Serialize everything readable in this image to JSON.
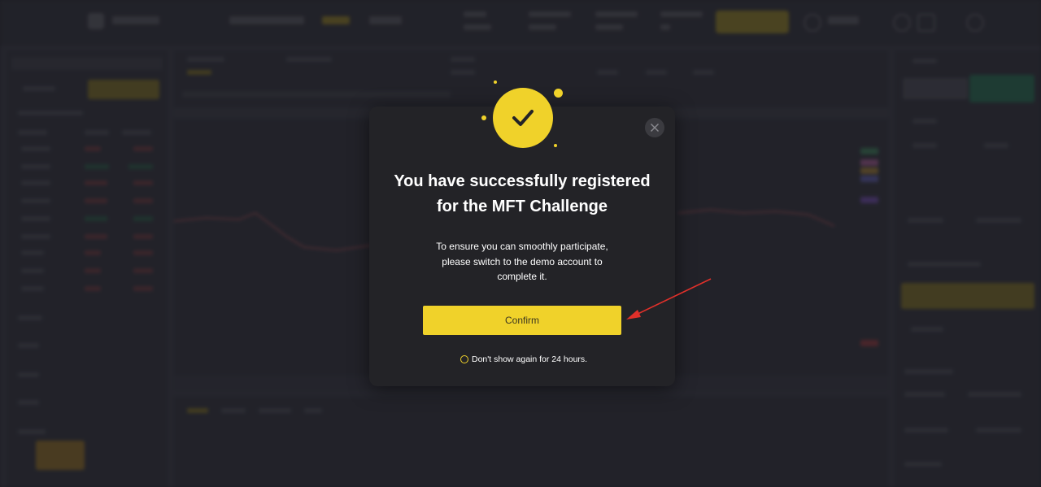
{
  "modal": {
    "title_line1": "You have successfully registered",
    "title_line2": "for the MFT Challenge",
    "body_line1": "To ensure you can smoothly participate,",
    "body_line2": "please switch to the demo account to",
    "body_line3": "complete it.",
    "confirm_label": "Confirm",
    "dont_show_label": "Don't show again for 24 hours."
  },
  "icons": {
    "success": "checkmark-icon",
    "close": "close-icon",
    "annotation": "red-arrow-icon"
  },
  "colors": {
    "accent": "#f0d22a",
    "modal_bg": "#232327",
    "annotation_arrow": "#e0302a"
  }
}
